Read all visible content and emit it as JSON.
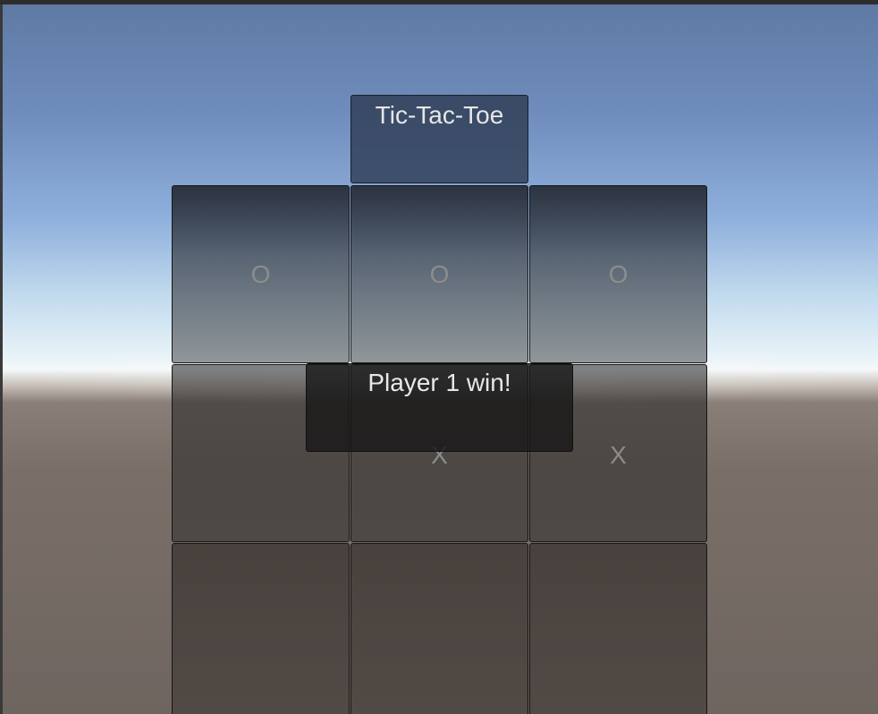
{
  "game": {
    "title": "Tic-Tac-Toe",
    "result_message": "Player 1 win!",
    "board": [
      [
        "O",
        "O",
        "O"
      ],
      [
        "",
        "X",
        "X"
      ],
      [
        "",
        "",
        ""
      ]
    ]
  },
  "colors": {
    "sky_top": "#5f7aa4",
    "horizon": "#f4f8fa",
    "ground": "#6f6560",
    "title_bg": "#2c3850",
    "cell_mark": "#8c8c8c",
    "text_light": "#e6e6e6"
  }
}
